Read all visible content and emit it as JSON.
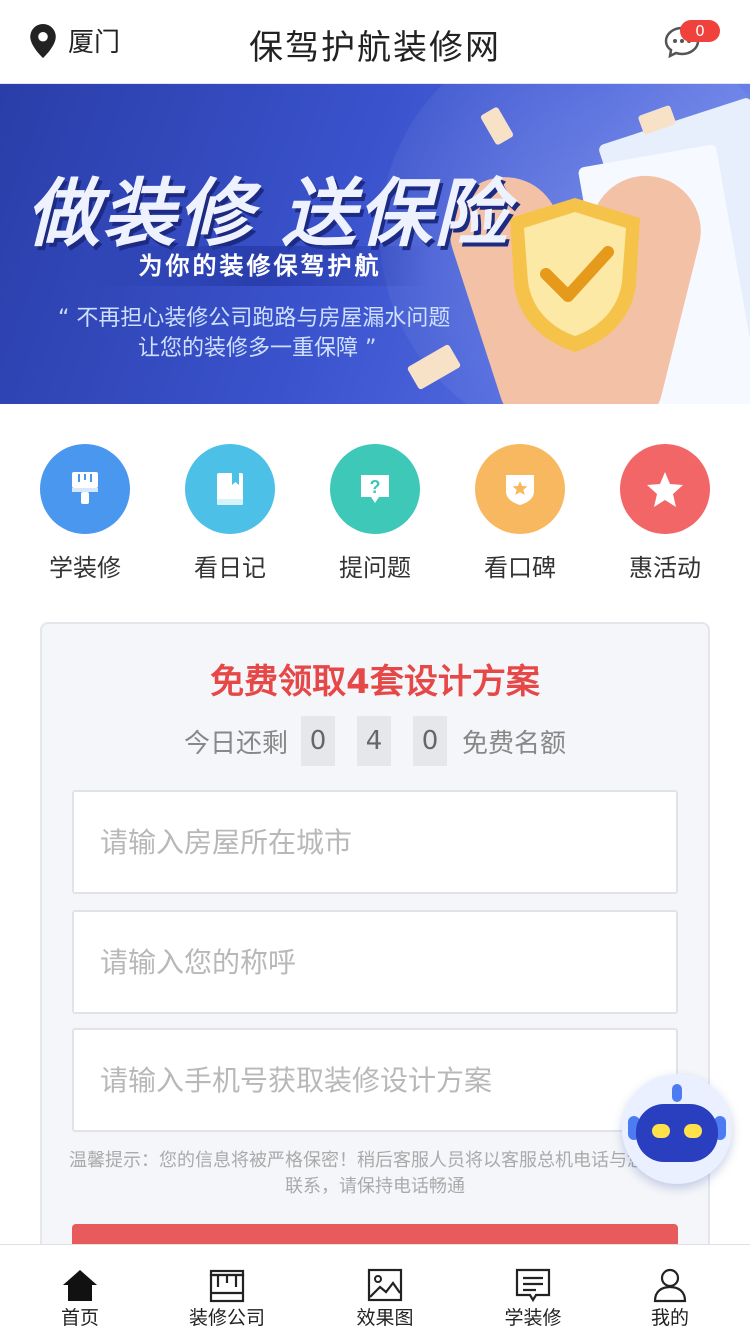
{
  "header": {
    "location": "厦门",
    "title": "保驾护航装修网",
    "message_count": "0",
    "icons": [
      "location-pin-icon",
      "chat-bubble-icon"
    ]
  },
  "banner": {
    "headline": "做装修 送保险",
    "subtitle": "为你的装修保驾护航",
    "quote_line1": "“ 不再担心装修公司跑路与房屋漏水问题",
    "quote_line2": "让您的装修多一重保障 ”"
  },
  "quick_links": [
    {
      "label": "学装修",
      "icon": "brush-icon",
      "color": "#4a97f0"
    },
    {
      "label": "看日记",
      "icon": "book-icon",
      "color": "#4dc0e8"
    },
    {
      "label": "提问题",
      "icon": "question-icon",
      "color": "#3ec8b8"
    },
    {
      "label": "看口碑",
      "icon": "badge-star-icon",
      "color": "#f7b860"
    },
    {
      "label": "惠活动",
      "icon": "star-icon",
      "color": "#f26668"
    }
  ],
  "form": {
    "title": "免费领取4套设计方案",
    "quota_prefix": "今日还剩",
    "quota_digits": [
      "0",
      "4",
      "0"
    ],
    "quota_suffix": "免费名额",
    "city_placeholder": "请输入房屋所在城市",
    "name_placeholder": "请输入您的称呼",
    "phone_placeholder": "请输入手机号获取装修设计方案",
    "tip": "温馨提示：您的信息将被严格保密！稍后客服人员将以客服总机电话与您取得联系，请保持电话畅通"
  },
  "tabbar": [
    {
      "label": "首页",
      "icon": "home-icon"
    },
    {
      "label": "装修公司",
      "icon": "company-icon"
    },
    {
      "label": "效果图",
      "icon": "image-icon"
    },
    {
      "label": "学装修",
      "icon": "document-icon"
    },
    {
      "label": "我的",
      "icon": "user-icon"
    }
  ],
  "colors": {
    "accent_red": "#e64848",
    "banner_blue": "#3a52cc"
  }
}
